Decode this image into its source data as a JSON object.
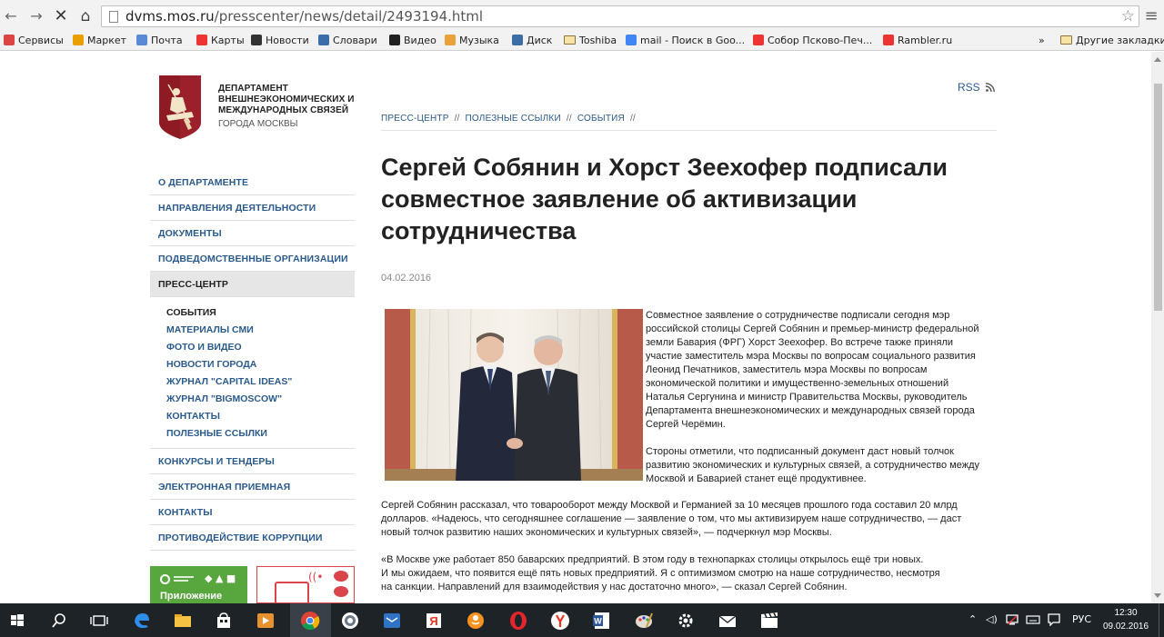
{
  "browser": {
    "url_host": "dvms.mos.ru",
    "url_path": "/presscenter/news/detail/2493194.html",
    "bookmarks": [
      {
        "label": "Сервисы",
        "icon": "apps-grid-icon",
        "color": "#d44"
      },
      {
        "label": "Маркет",
        "icon": "market-icon",
        "color": "#e8a000"
      },
      {
        "label": "Почта",
        "icon": "mail-icon",
        "color": "#5a8ad6"
      },
      {
        "label": "Карты",
        "icon": "map-pin-icon",
        "color": "#e33"
      },
      {
        "label": "Новости",
        "icon": "news-icon",
        "color": "#333"
      },
      {
        "label": "Словари",
        "icon": "dictionary-icon",
        "color": "#3b6ea8"
      },
      {
        "label": "Видео",
        "icon": "video-icon",
        "color": "#222"
      },
      {
        "label": "Музыка",
        "icon": "music-icon",
        "color": "#e9a13b"
      },
      {
        "label": "Диск",
        "icon": "disk-icon",
        "color": "#3b6ea8"
      },
      {
        "label": "Toshiba",
        "icon": "folder-icon",
        "color": "#e8c86a"
      },
      {
        "label": "mail - Поиск в Goo...",
        "icon": "google-icon",
        "color": "#4285f4"
      },
      {
        "label": "Собор Псково-Печ...",
        "icon": "yandex-icon",
        "color": "#e33"
      },
      {
        "label": "Rambler.ru",
        "icon": "yandex-icon",
        "color": "#e33"
      }
    ],
    "more_label": "»",
    "other_bookmarks": "Другие закладки"
  },
  "site": {
    "dept_lines": [
      "ДЕПАРТАМЕНТ",
      "ВНЕШНЕЭКОНОМИЧЕСКИХ И",
      "МЕЖДУНАРОДНЫХ СВЯЗЕЙ"
    ],
    "dept_city": "ГОРОДА МОСКВЫ",
    "rss": "RSS",
    "breadcrumbs": [
      "ПРЕСС-ЦЕНТР",
      "ПОЛЕЗНЫЕ ССЫЛКИ",
      "СОБЫТИЯ"
    ],
    "crumb_sep": "//",
    "menu_top": [
      "О ДЕПАРТАМЕНТЕ",
      "НАПРАВЛЕНИЯ ДЕЯТЕЛЬНОСТИ",
      "ДОКУМЕНТЫ",
      "ПОДВЕДОМСТВЕННЫЕ ОРГАНИЗАЦИИ",
      "ПРЕСС-ЦЕНТР"
    ],
    "submenu": [
      "СОБЫТИЯ",
      "МАТЕРИАЛЫ СМИ",
      "ФОТО И ВИДЕО",
      "НОВОСТИ ГОРОДА",
      "ЖУРНАЛ \"CAPITAL IDEAS\"",
      "ЖУРНАЛ \"BIGMOSCOW\"",
      "КОНТАКТЫ",
      "ПОЛЕЗНЫЕ ССЫЛКИ"
    ],
    "menu_bottom": [
      "КОНКУРСЫ И ТЕНДЕРЫ",
      "ЭЛЕКТРОННАЯ ПРИЕМНАЯ",
      "КОНТАКТЫ",
      "ПРОТИВОДЕЙСТВИЕ КОРРУПЦИИ"
    ],
    "banner_label": "Приложение"
  },
  "article": {
    "title_lines": [
      "Сергей Собянин и Хорст Зеехофер подписали",
      "совместное заявление об активизации",
      "сотрудничества"
    ],
    "date": "04.02.2016",
    "p1": [
      "Совместное заявление о сотрудничестве подписали сегодня мэр",
      "российской столицы Сергей Собянин и премьер-министр федеральной",
      "земли Бавария (ФРГ) Хорст Зеехофер. Во встрече также приняли",
      "участие заместитель мэра Москвы по вопросам социального развития",
      "Леонид Печатников, заместитель мэра Москвы по вопросам",
      "экономической политики и имущественно-земельных отношений",
      "Наталья Сергунина и министр Правительства Москвы, руководитель",
      "Департамента внешнеэкономических и международных связей города",
      "Сергей Черёмин."
    ],
    "p2": [
      "Стороны отметили, что подписанный документ даст новый толчок",
      "развитию экономических и культурных связей, а сотрудничество между",
      "Москвой и Баварией станет ещё продуктивнее."
    ],
    "p3": [
      "Сергей Собянин рассказал, что товарооборот между Москвой и Германией за 10 месяцев прошлого года составил 20 млрд",
      "долларов. «Надеюсь, что сегодняшнее соглашение — заявление о том, что мы активизируем наше сотрудничество, — даст",
      "новый толчок развитию наших экономических и культурных связей», — подчеркнул мэр Москвы."
    ],
    "p4": [
      "«В Москве уже работает 850 баварских предприятий. В этом году в технопарках столицы открылось ещё три новых.",
      "И мы ожидаем, что появится ещё пять новых предприятий. Я с оптимизмом смотрю на наше сотрудничество, несмотря",
      "на санкции. Направлений для взаимодействия у нас достаточно много», — сказал Сергей Собянин."
    ]
  },
  "taskbar": {
    "lang": "РУС",
    "time": "12:30",
    "date": "09.02.2016"
  },
  "colors": {
    "link": "#2a5a8c",
    "accent_red": "#8e1b24",
    "taskbar": "#1e2328"
  }
}
